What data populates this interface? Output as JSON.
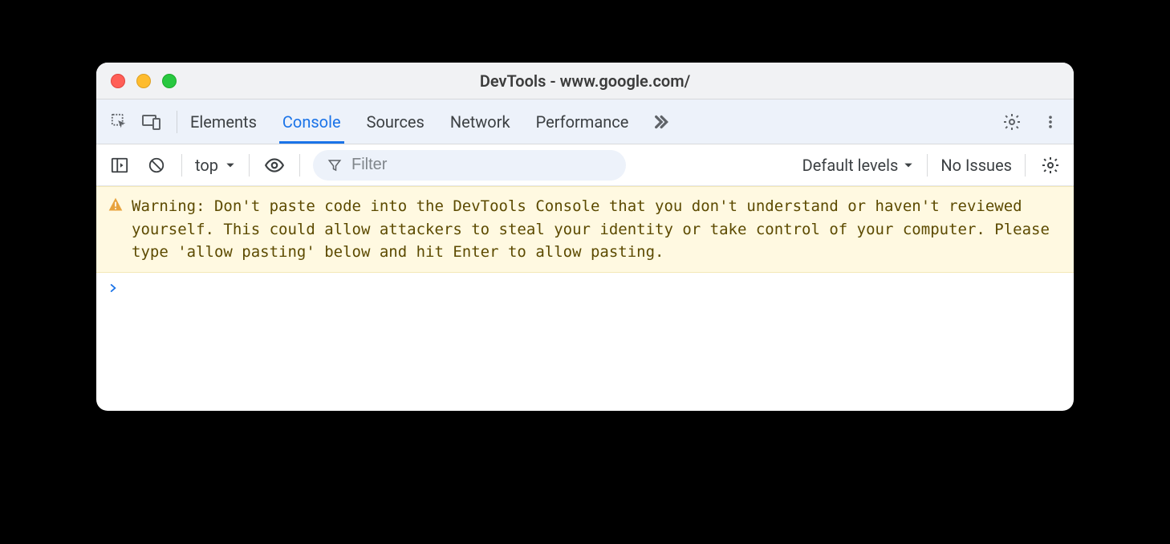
{
  "window": {
    "title": "DevTools - www.google.com/"
  },
  "tabs": {
    "elements": "Elements",
    "console": "Console",
    "sources": "Sources",
    "network": "Network",
    "performance": "Performance"
  },
  "consolebar": {
    "context": "top",
    "filter_placeholder": "Filter",
    "levels": "Default levels",
    "issues": "No Issues"
  },
  "console": {
    "warning": "Warning: Don't paste code into the DevTools Console that you don't understand or haven't reviewed yourself. This could allow attackers to steal your identity or take control of your computer. Please type 'allow pasting' below and hit Enter to allow pasting."
  }
}
